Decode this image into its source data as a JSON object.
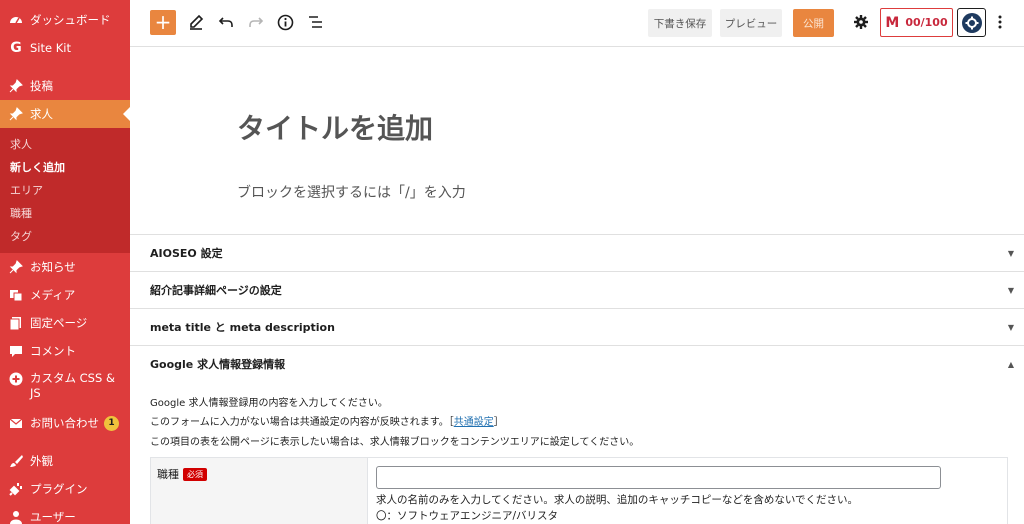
{
  "sidebar": {
    "items": [
      {
        "label": "ダッシュボード",
        "icon": "dashboard-icon"
      },
      {
        "label": "Site Kit",
        "icon": "google-g-icon"
      },
      {
        "label": "投稿",
        "icon": "pin-icon"
      },
      {
        "label": "求人",
        "icon": "pin-icon",
        "active": true
      },
      {
        "label": "お知らせ",
        "icon": "pin-icon"
      },
      {
        "label": "メディア",
        "icon": "media-icon"
      },
      {
        "label": "固定ページ",
        "icon": "page-icon"
      },
      {
        "label": "コメント",
        "icon": "comment-icon"
      },
      {
        "label": "カスタム CSS & JS",
        "icon": "plus-circle-icon"
      },
      {
        "label": "お問い合わせ",
        "icon": "mail-icon",
        "badge": "1"
      },
      {
        "label": "外観",
        "icon": "brush-icon"
      },
      {
        "label": "プラグイン",
        "icon": "plugin-icon"
      },
      {
        "label": "ユーザー",
        "icon": "user-icon"
      }
    ],
    "submenu": [
      "求人",
      "新しく追加",
      "エリア",
      "職種",
      "タグ"
    ]
  },
  "toolbar": {
    "add_label": "+",
    "save_draft": "下書き保存",
    "preview": "プレビュー",
    "publish": "公開",
    "score": "00/100",
    "score_mark": "M"
  },
  "editor": {
    "title_placeholder": "タイトルを追加",
    "block_placeholder": "ブロックを選択するには「/」を入力"
  },
  "panels": [
    {
      "title": "AIOSEO 設定",
      "expanded": false
    },
    {
      "title": "紹介記事詳細ページの設定",
      "expanded": false
    },
    {
      "title": "meta title と meta description",
      "expanded": false
    },
    {
      "title": "Google 求人情報登録情報",
      "expanded": true
    }
  ],
  "job_panel": {
    "desc1": "Google 求人情報登録用の内容を入力してください。",
    "desc2_pre": "このフォームに入力がない場合は共通設定の内容が反映されます。［",
    "desc2_link": "共通設定",
    "desc2_post": "］",
    "desc3": "この項目の表を公開ページに表示したい場合は、求人情報ブロックをコンテンツエリアに設定してください。",
    "field_label": "職種",
    "required": "必須",
    "field_value": "",
    "help1": "求人の名前のみを入力してください。求人の説明、追加のキャッチコピーなどを含めないでください。",
    "help2": "〇：ソフトウェアエンジニア/バリスタ"
  },
  "colors": {
    "sidebar_bg": "#dd3c3c",
    "accent": "#e9863f",
    "link": "#2271b1",
    "required": "#d10000"
  }
}
